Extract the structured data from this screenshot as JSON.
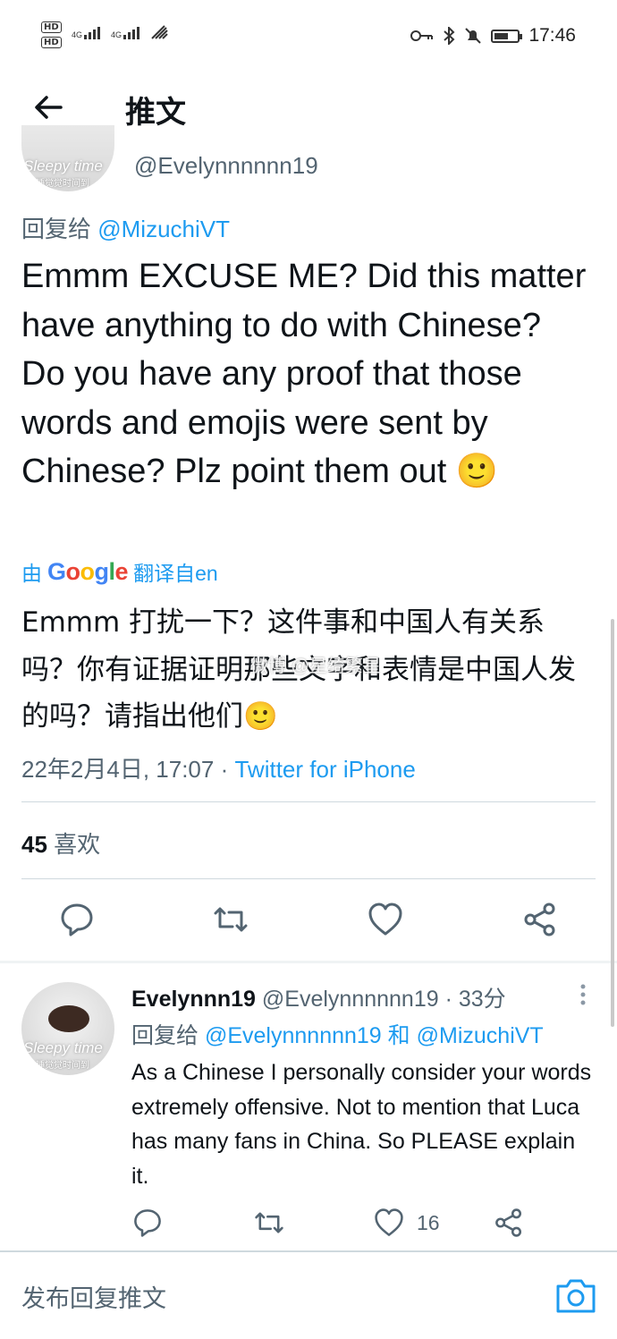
{
  "status_bar": {
    "hd1": "HD",
    "hd2": "HD",
    "network1": "4G",
    "network2": "4G",
    "time": "17:46",
    "battery_level": 0.6
  },
  "header": {
    "title": "推文"
  },
  "main_tweet": {
    "handle": "@Evelynnnnnn19",
    "avatar_caption": "Sleepy time",
    "avatar_caption_cn": "睡觉觉时间到",
    "reply_prefix": "回复给",
    "reply_mention": "@MizuchiVT",
    "text": "Emmm EXCUSE ME? Did this matter have anything to do with Chinese? Do you have any proof that those words and emojis were sent by Chinese? Plz point them out 🙂",
    "translate_prefix": "由",
    "translate_suffix": "翻译自en",
    "translated_text": "Emmm 打扰一下？这件事和中国人有关系吗？你有证据证明那些文字和表情是中国人发的吗？请指出他们🙂",
    "watermark": "微博 @星绮繁星",
    "timestamp": "22年2月4日, 17:07 · ",
    "source": "Twitter for iPhone",
    "likes_count": "45",
    "likes_label": "喜欢"
  },
  "reply_tweet": {
    "name": "Evelynnn19",
    "handle_meta": "@Evelynnnnnn19 · 33分",
    "avatar_caption": "Sleepy time",
    "avatar_caption_cn": "睡觉觉时间到",
    "reply_prefix": "回复给",
    "reply_mention1": "@Evelynnnnnn19",
    "reply_and": "和",
    "reply_mention2": "@MizuchiVT",
    "text": "As a Chinese I personally consider your words extremely offensive. Not to mention that Luca has many fans in China. So PLEASE explain it.",
    "like_count": "16"
  },
  "compose": {
    "placeholder": "发布回复推文"
  },
  "colors": {
    "accent": "#1d9bf0",
    "text": "#0f1419",
    "muted": "#536471",
    "divider": "#cfd9de"
  }
}
